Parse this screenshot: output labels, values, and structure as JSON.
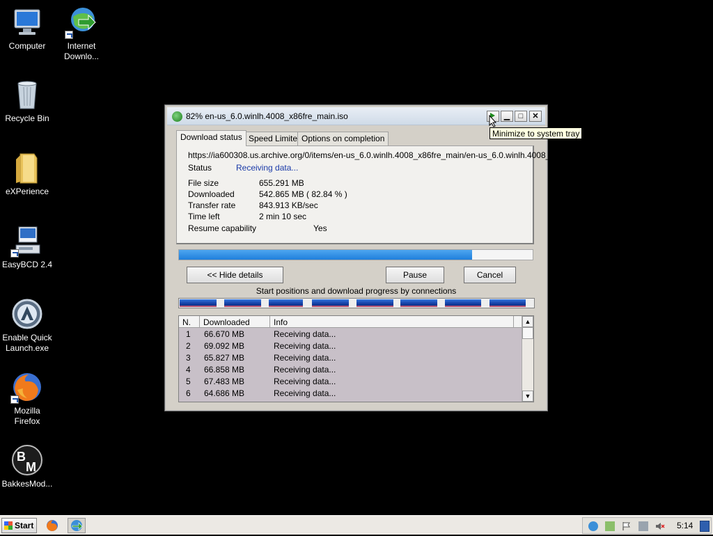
{
  "desktop": {
    "icons": [
      {
        "label": "Computer",
        "icon": "computer-icon"
      },
      {
        "label": "Internet\nDownlo...",
        "icon": "internet-download-manager-icon"
      },
      {
        "label": "Recycle Bin",
        "icon": "recycle-bin-icon"
      },
      {
        "label": "eXPerience",
        "icon": "folder-icon"
      },
      {
        "label": "EasyBCD 2.4",
        "icon": "easybcd-icon"
      },
      {
        "label": "Enable Quick\nLaunch.exe",
        "icon": "quick-launch-icon"
      },
      {
        "label": "Mozilla\nFirefox",
        "icon": "firefox-icon"
      },
      {
        "label": "BakkesMod...",
        "icon": "bakkesmod-icon"
      }
    ]
  },
  "window": {
    "title": "82% en-us_6.0.winlh.4008_x86fre_main.iso",
    "tooltip": "Minimize to system tray",
    "tabs": [
      "Download status",
      "Speed Limiter",
      "Options on completion"
    ],
    "url": "https://ia600308.us.archive.org/0/items/en-us_6.0.winlh.4008_x86fre_main/en-us_6.0.winlh.4008_",
    "status_label": "Status",
    "status_value": "Receiving data...",
    "details": [
      {
        "label": "File size",
        "value": "655.291  MB"
      },
      {
        "label": "Downloaded",
        "value": "542.865  MB  ( 82.84 % )"
      },
      {
        "label": "Transfer rate",
        "value": "843.913  KB/sec"
      },
      {
        "label": "Time left",
        "value": "2 min 10 sec"
      },
      {
        "label": "Resume capability",
        "value": "Yes"
      }
    ],
    "progress_fraction": 0.8284,
    "buttons": {
      "hide_details": "<< Hide details",
      "pause": "Pause",
      "cancel": "Cancel"
    },
    "connections_caption": "Start positions and download progress by connections",
    "table": {
      "headers": [
        "N.",
        "Downloaded",
        "Info"
      ],
      "rows": [
        {
          "n": "1",
          "downloaded": "66.670  MB",
          "info": "Receiving data..."
        },
        {
          "n": "2",
          "downloaded": "69.092  MB",
          "info": "Receiving data..."
        },
        {
          "n": "3",
          "downloaded": "65.827  MB",
          "info": "Receiving data..."
        },
        {
          "n": "4",
          "downloaded": "66.858  MB",
          "info": "Receiving data..."
        },
        {
          "n": "5",
          "downloaded": "67.483  MB",
          "info": "Receiving data..."
        },
        {
          "n": "6",
          "downloaded": "64.686  MB",
          "info": "Receiving data..."
        }
      ]
    }
  },
  "taskbar": {
    "start_label": "Start",
    "clock": "5:14"
  },
  "colors": {
    "accent": "#1f7fdc",
    "status_text": "#1a3aa8",
    "tooltip_bg": "#ffffe1"
  }
}
